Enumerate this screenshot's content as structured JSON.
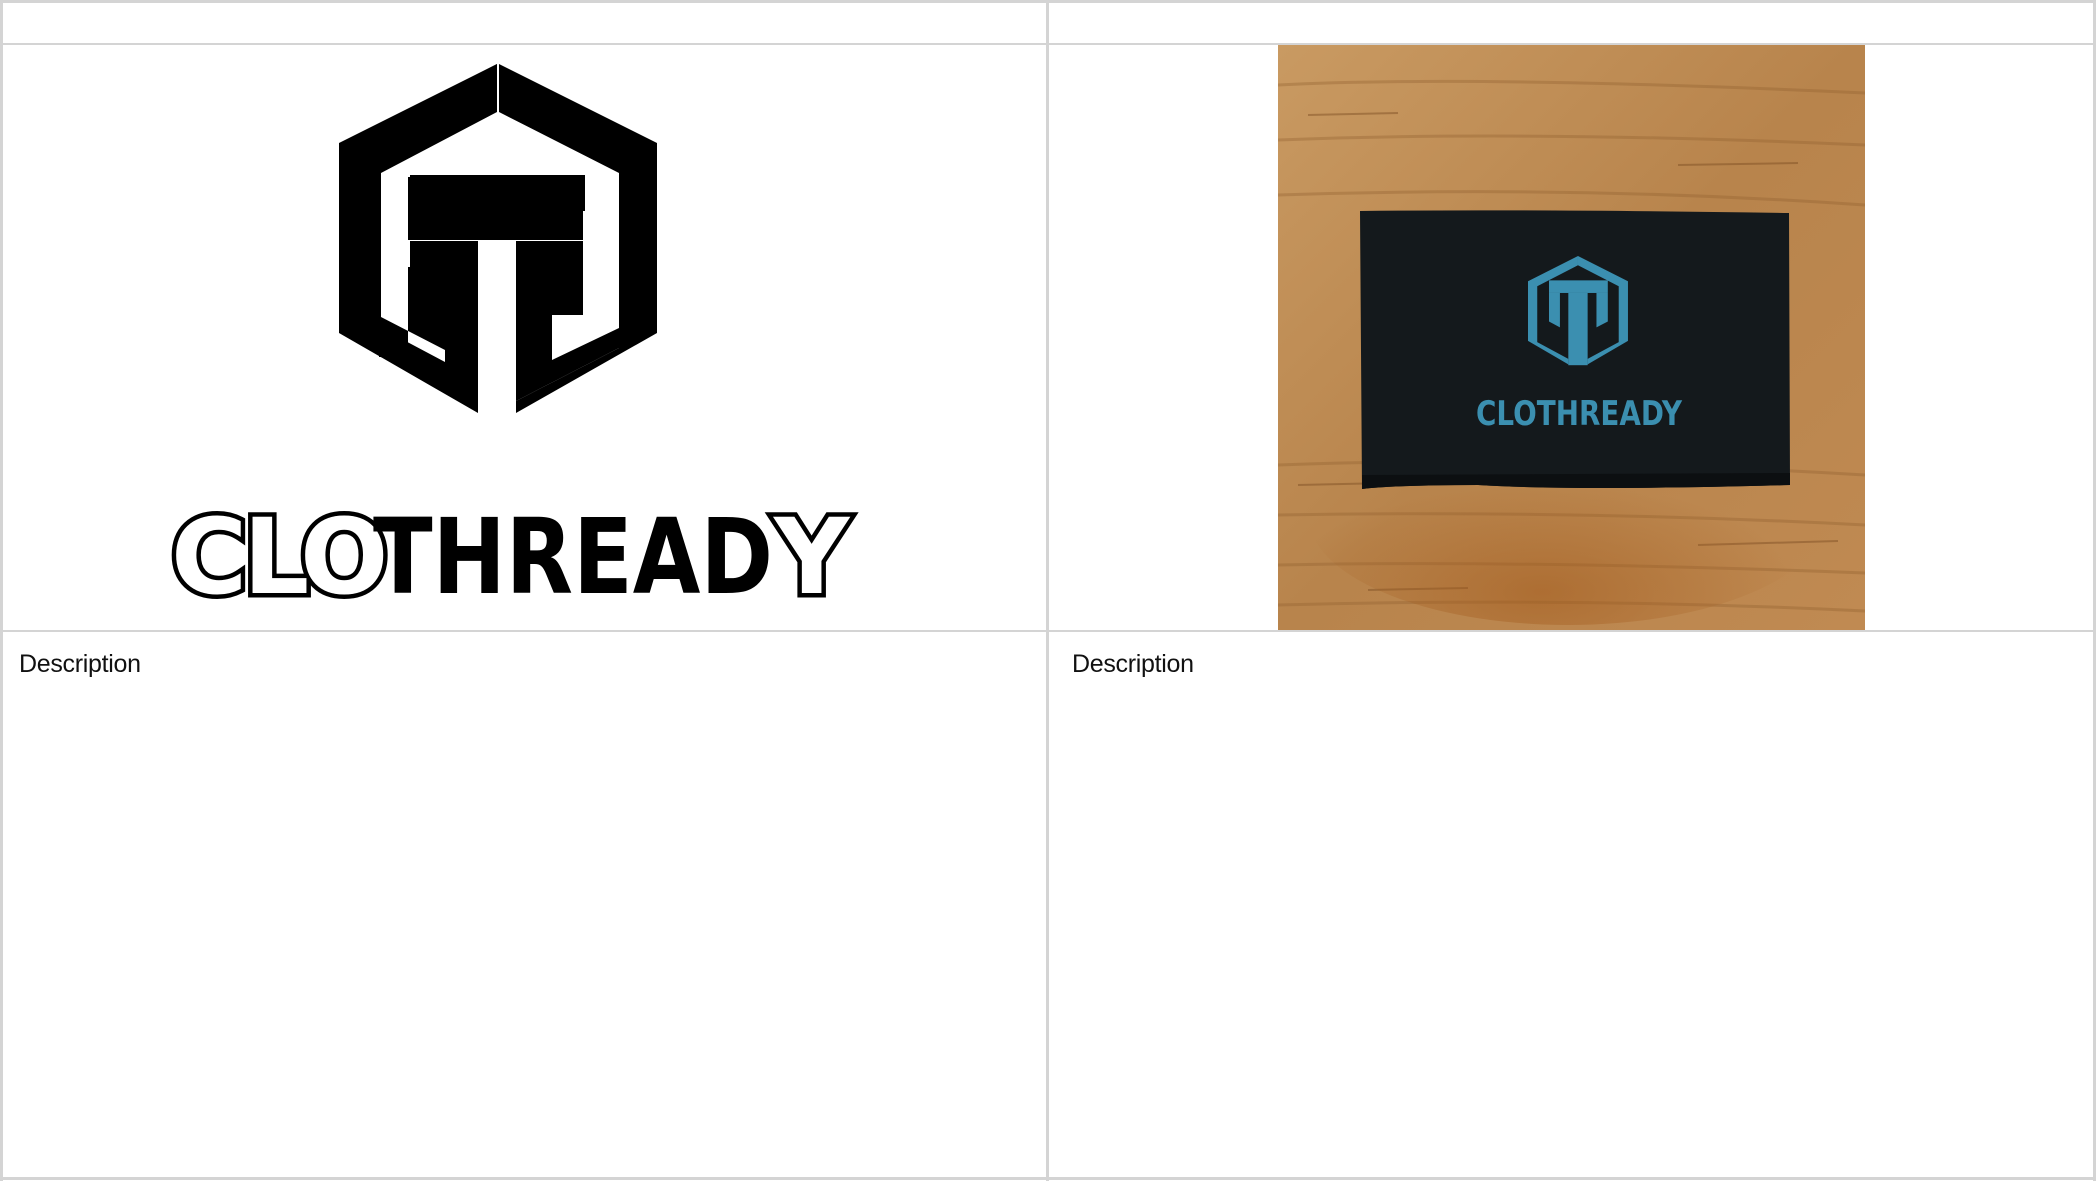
{
  "table": {
    "left_cell": {
      "image": {
        "kind": "brand-logo",
        "wordmark": "CLOTHREADY",
        "color": "#000000"
      },
      "description_label": "Description"
    },
    "right_cell": {
      "image": {
        "kind": "photo-woven-label",
        "wordmark": "CLOTHREADY",
        "label_color": "#14191c",
        "print_color": "#3b8fb0",
        "background": "wood-surface"
      },
      "description_label": "Description"
    }
  }
}
